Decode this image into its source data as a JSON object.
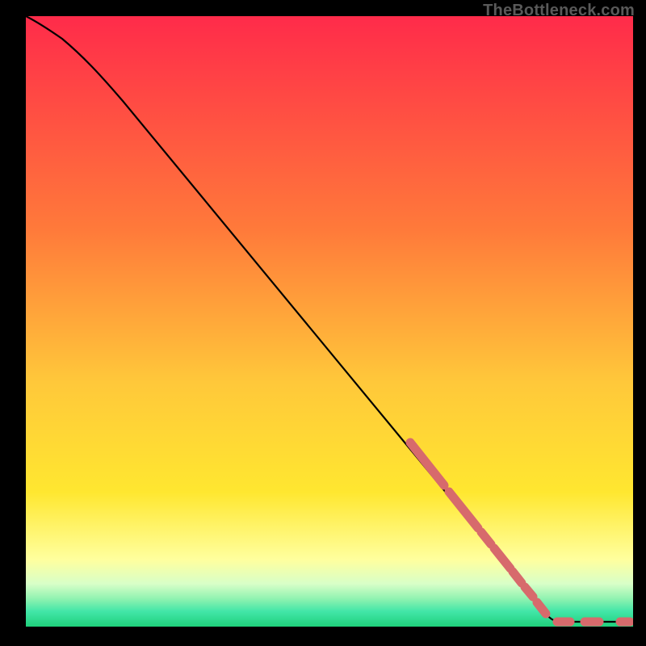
{
  "watermark": "TheBottleneck.com",
  "gradient_colors": {
    "top": "#ff2b4a",
    "mid_orange": "#ff8a3a",
    "yellow": "#ffe730",
    "pale_yellow": "#ffff9e",
    "pale_green": "#b4ffb4",
    "cyan_green": "#42e6a8",
    "bottom_green": "#1fd07b"
  },
  "curve_color": "#000000",
  "segment_color": "#d76a6c",
  "chart_data": {
    "type": "line",
    "title": "",
    "xlabel": "",
    "ylabel": "",
    "xlim": [
      0,
      100
    ],
    "ylim": [
      0,
      100
    ],
    "series": [
      {
        "name": "curve",
        "style": "solid",
        "x": [
          0,
          3,
          6,
          10,
          15,
          20,
          25,
          30,
          35,
          40,
          45,
          50,
          55,
          60,
          65,
          70,
          75,
          80,
          85,
          87,
          89,
          91,
          93,
          95,
          97,
          99,
          100
        ],
        "y": [
          100,
          98.6,
          96.2,
          92,
          86,
          79.8,
          73.5,
          67.2,
          60.9,
          54.6,
          48.3,
          42,
          35.7,
          29.4,
          23.1,
          16.8,
          10.5,
          4.5,
          1,
          0.8,
          0.7,
          0.7,
          0.7,
          0.7,
          0.7,
          0.7,
          0.7
        ]
      },
      {
        "name": "highlight-segments",
        "style": "dash-dot-thick",
        "x": [
          63,
          65,
          67,
          69,
          71,
          73,
          74,
          76,
          78,
          80,
          82,
          85,
          86,
          88,
          90,
          92,
          94,
          97,
          99,
          100
        ],
        "y": [
          25.6,
          23.1,
          20.6,
          18.1,
          15.6,
          13.1,
          11.8,
          9.3,
          6.9,
          4.5,
          2.5,
          1.1,
          0.8,
          0.7,
          0.7,
          0.7,
          0.7,
          0.7,
          0.7,
          0.7
        ]
      }
    ],
    "gradient_stops": [
      {
        "offset": 0.0,
        "color": "#ff2b4a"
      },
      {
        "offset": 0.35,
        "color": "#ff7a3a"
      },
      {
        "offset": 0.6,
        "color": "#ffc83a"
      },
      {
        "offset": 0.78,
        "color": "#ffe730"
      },
      {
        "offset": 0.89,
        "color": "#ffff9e"
      },
      {
        "offset": 0.93,
        "color": "#d8ffc8"
      },
      {
        "offset": 0.955,
        "color": "#8ef2b0"
      },
      {
        "offset": 0.975,
        "color": "#42e6a8"
      },
      {
        "offset": 1.0,
        "color": "#1fd07b"
      }
    ]
  }
}
